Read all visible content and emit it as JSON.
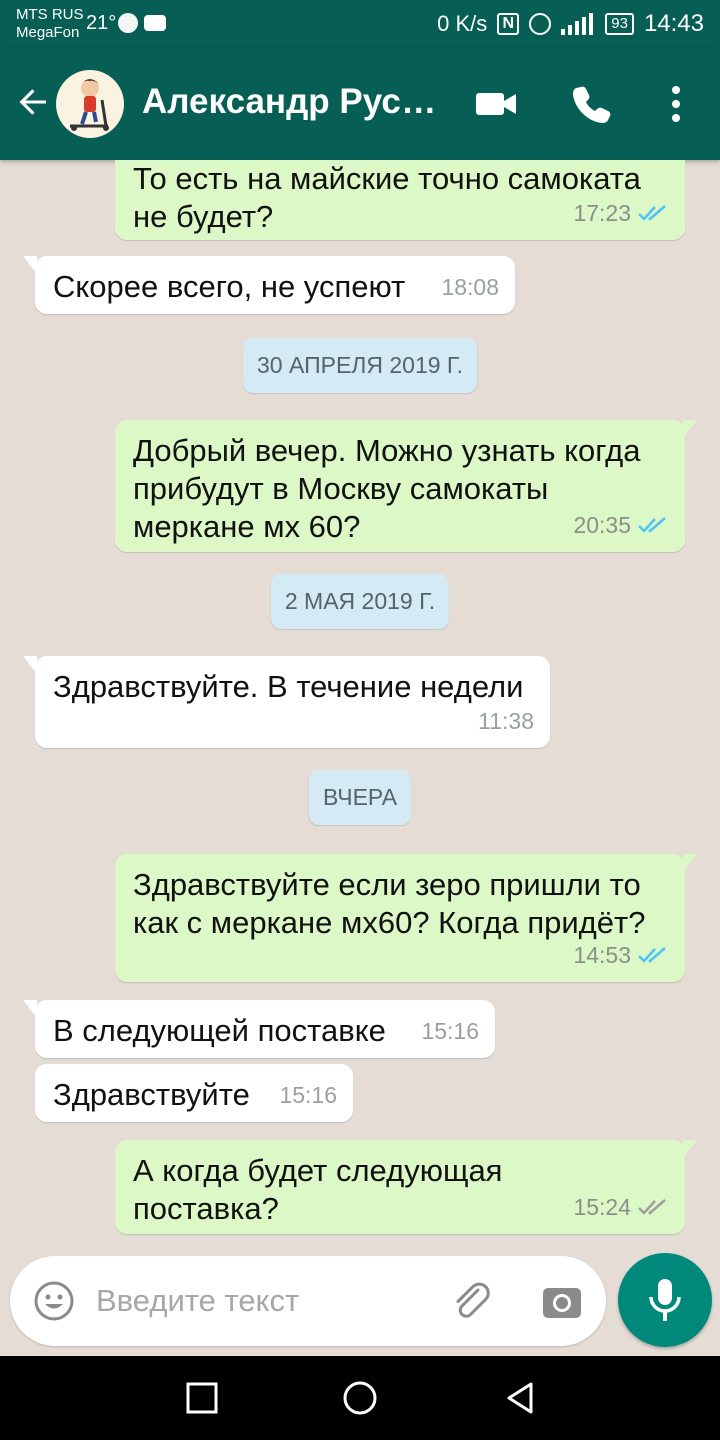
{
  "status_bar": {
    "carrier1": "MTS RUS",
    "carrier2": "MegaFon",
    "temperature": "21°",
    "speed": "0 K/s",
    "battery": "93",
    "time": "14:43"
  },
  "header": {
    "contact_name": "Александр Руса...",
    "icons": [
      "back-arrow-icon",
      "avatar",
      "video-call-icon",
      "phone-icon",
      "more-vert-icon"
    ]
  },
  "messages": [
    {
      "type": "out",
      "text": "То есть на майские точно самоката не будет?",
      "time": "17:23",
      "status": "read"
    },
    {
      "type": "in",
      "text": "Скорее всего, не успеют",
      "time": "18:08"
    },
    {
      "type": "date",
      "text": "30 АПРЕЛЯ 2019 Г."
    },
    {
      "type": "out",
      "text": "Добрый вечер. Можно узнать когда прибудут в Москву самокаты меркане мх 60?",
      "time": "20:35",
      "status": "read"
    },
    {
      "type": "date",
      "text": "2 МАЯ 2019 Г."
    },
    {
      "type": "in",
      "text": "Здравствуйте. В течение недели",
      "time": "11:38"
    },
    {
      "type": "date",
      "text": "ВЧЕРА"
    },
    {
      "type": "out",
      "text": "Здравствуйте если зеро пришли то как с меркане мх60? Когда придёт?",
      "time": "14:53",
      "status": "read"
    },
    {
      "type": "in",
      "text": "В следующей поставке",
      "time": "15:16"
    },
    {
      "type": "in",
      "text": "Здравствуйте",
      "time": "15:16"
    },
    {
      "type": "out",
      "text": "А когда будет следующая поставка?",
      "time": "15:24",
      "status": "delivered"
    }
  ],
  "input": {
    "placeholder": "Введите текст"
  },
  "colors": {
    "header": "#075e54",
    "outgoing_bubble": "#dcf8c6",
    "incoming_bubble": "#ffffff",
    "read_ticks": "#4fc3f7",
    "delivered_ticks": "#9e9e9e",
    "mic_button": "#00897b"
  }
}
